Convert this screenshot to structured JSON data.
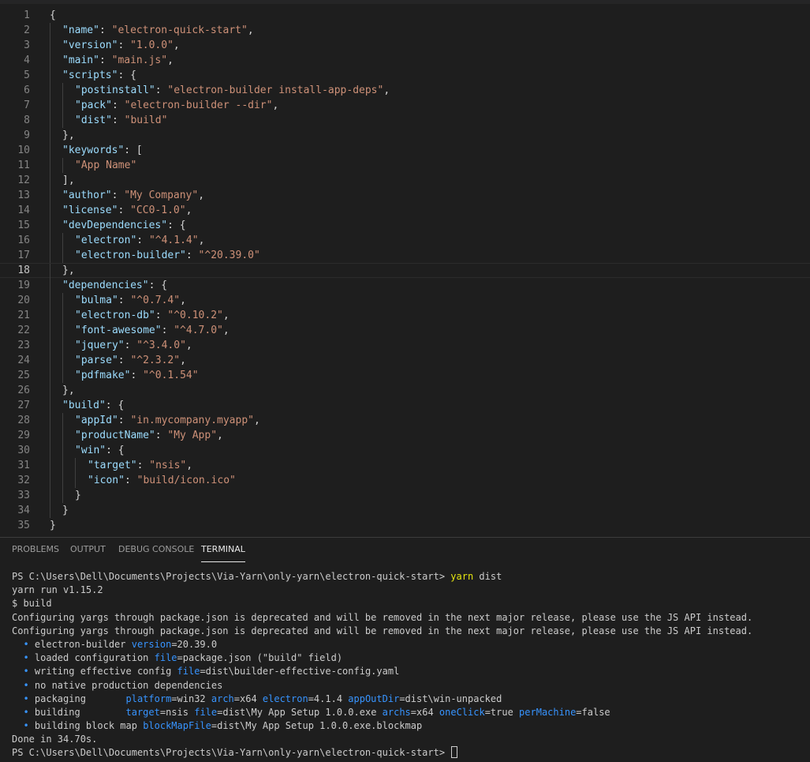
{
  "editor": {
    "active_line": 18,
    "lines": [
      {
        "n": "1",
        "indent": 0,
        "tokens": [
          {
            "c": "p",
            "t": "{"
          }
        ]
      },
      {
        "n": "2",
        "indent": 1,
        "tokens": [
          {
            "c": "k",
            "t": "\"name\""
          },
          {
            "c": "p",
            "t": ": "
          },
          {
            "c": "s",
            "t": "\"electron-quick-start\""
          },
          {
            "c": "p",
            "t": ","
          }
        ]
      },
      {
        "n": "3",
        "indent": 1,
        "tokens": [
          {
            "c": "k",
            "t": "\"version\""
          },
          {
            "c": "p",
            "t": ": "
          },
          {
            "c": "s",
            "t": "\"1.0.0\""
          },
          {
            "c": "p",
            "t": ","
          }
        ]
      },
      {
        "n": "4",
        "indent": 1,
        "tokens": [
          {
            "c": "k",
            "t": "\"main\""
          },
          {
            "c": "p",
            "t": ": "
          },
          {
            "c": "s",
            "t": "\"main.js\""
          },
          {
            "c": "p",
            "t": ","
          }
        ]
      },
      {
        "n": "5",
        "indent": 1,
        "tokens": [
          {
            "c": "k",
            "t": "\"scripts\""
          },
          {
            "c": "p",
            "t": ": {"
          }
        ]
      },
      {
        "n": "6",
        "indent": 2,
        "tokens": [
          {
            "c": "k",
            "t": "\"postinstall\""
          },
          {
            "c": "p",
            "t": ": "
          },
          {
            "c": "s",
            "t": "\"electron-builder install-app-deps\""
          },
          {
            "c": "p",
            "t": ","
          }
        ]
      },
      {
        "n": "7",
        "indent": 2,
        "tokens": [
          {
            "c": "k",
            "t": "\"pack\""
          },
          {
            "c": "p",
            "t": ": "
          },
          {
            "c": "s",
            "t": "\"electron-builder --dir\""
          },
          {
            "c": "p",
            "t": ","
          }
        ]
      },
      {
        "n": "8",
        "indent": 2,
        "tokens": [
          {
            "c": "k",
            "t": "\"dist\""
          },
          {
            "c": "p",
            "t": ": "
          },
          {
            "c": "s",
            "t": "\"build\""
          }
        ]
      },
      {
        "n": "9",
        "indent": 1,
        "tokens": [
          {
            "c": "p",
            "t": "},"
          }
        ]
      },
      {
        "n": "10",
        "indent": 1,
        "tokens": [
          {
            "c": "k",
            "t": "\"keywords\""
          },
          {
            "c": "p",
            "t": ": ["
          }
        ]
      },
      {
        "n": "11",
        "indent": 2,
        "tokens": [
          {
            "c": "s",
            "t": "\"App Name\""
          }
        ]
      },
      {
        "n": "12",
        "indent": 1,
        "tokens": [
          {
            "c": "p",
            "t": "],"
          }
        ]
      },
      {
        "n": "13",
        "indent": 1,
        "tokens": [
          {
            "c": "k",
            "t": "\"author\""
          },
          {
            "c": "p",
            "t": ": "
          },
          {
            "c": "s",
            "t": "\"My Company\""
          },
          {
            "c": "p",
            "t": ","
          }
        ]
      },
      {
        "n": "14",
        "indent": 1,
        "tokens": [
          {
            "c": "k",
            "t": "\"license\""
          },
          {
            "c": "p",
            "t": ": "
          },
          {
            "c": "s",
            "t": "\"CC0-1.0\""
          },
          {
            "c": "p",
            "t": ","
          }
        ]
      },
      {
        "n": "15",
        "indent": 1,
        "tokens": [
          {
            "c": "k",
            "t": "\"devDependencies\""
          },
          {
            "c": "p",
            "t": ": {"
          }
        ]
      },
      {
        "n": "16",
        "indent": 2,
        "tokens": [
          {
            "c": "k",
            "t": "\"electron\""
          },
          {
            "c": "p",
            "t": ": "
          },
          {
            "c": "s",
            "t": "\"^4.1.4\""
          },
          {
            "c": "p",
            "t": ","
          }
        ]
      },
      {
        "n": "17",
        "indent": 2,
        "tokens": [
          {
            "c": "k",
            "t": "\"electron-builder\""
          },
          {
            "c": "p",
            "t": ": "
          },
          {
            "c": "s",
            "t": "\"^20.39.0\""
          }
        ]
      },
      {
        "n": "18",
        "indent": 1,
        "tokens": [
          {
            "c": "p",
            "t": "},"
          }
        ]
      },
      {
        "n": "19",
        "indent": 1,
        "tokens": [
          {
            "c": "k",
            "t": "\"dependencies\""
          },
          {
            "c": "p",
            "t": ": {"
          }
        ]
      },
      {
        "n": "20",
        "indent": 2,
        "tokens": [
          {
            "c": "k",
            "t": "\"bulma\""
          },
          {
            "c": "p",
            "t": ": "
          },
          {
            "c": "s",
            "t": "\"^0.7.4\""
          },
          {
            "c": "p",
            "t": ","
          }
        ]
      },
      {
        "n": "21",
        "indent": 2,
        "tokens": [
          {
            "c": "k",
            "t": "\"electron-db\""
          },
          {
            "c": "p",
            "t": ": "
          },
          {
            "c": "s",
            "t": "\"^0.10.2\""
          },
          {
            "c": "p",
            "t": ","
          }
        ]
      },
      {
        "n": "22",
        "indent": 2,
        "tokens": [
          {
            "c": "k",
            "t": "\"font-awesome\""
          },
          {
            "c": "p",
            "t": ": "
          },
          {
            "c": "s",
            "t": "\"^4.7.0\""
          },
          {
            "c": "p",
            "t": ","
          }
        ]
      },
      {
        "n": "23",
        "indent": 2,
        "tokens": [
          {
            "c": "k",
            "t": "\"jquery\""
          },
          {
            "c": "p",
            "t": ": "
          },
          {
            "c": "s",
            "t": "\"^3.4.0\""
          },
          {
            "c": "p",
            "t": ","
          }
        ]
      },
      {
        "n": "24",
        "indent": 2,
        "tokens": [
          {
            "c": "k",
            "t": "\"parse\""
          },
          {
            "c": "p",
            "t": ": "
          },
          {
            "c": "s",
            "t": "\"^2.3.2\""
          },
          {
            "c": "p",
            "t": ","
          }
        ]
      },
      {
        "n": "25",
        "indent": 2,
        "tokens": [
          {
            "c": "k",
            "t": "\"pdfmake\""
          },
          {
            "c": "p",
            "t": ": "
          },
          {
            "c": "s",
            "t": "\"^0.1.54\""
          }
        ]
      },
      {
        "n": "26",
        "indent": 1,
        "tokens": [
          {
            "c": "p",
            "t": "},"
          }
        ]
      },
      {
        "n": "27",
        "indent": 1,
        "tokens": [
          {
            "c": "k",
            "t": "\"build\""
          },
          {
            "c": "p",
            "t": ": {"
          }
        ]
      },
      {
        "n": "28",
        "indent": 2,
        "tokens": [
          {
            "c": "k",
            "t": "\"appId\""
          },
          {
            "c": "p",
            "t": ": "
          },
          {
            "c": "s",
            "t": "\"in.mycompany.myapp\""
          },
          {
            "c": "p",
            "t": ","
          }
        ]
      },
      {
        "n": "29",
        "indent": 2,
        "tokens": [
          {
            "c": "k",
            "t": "\"productName\""
          },
          {
            "c": "p",
            "t": ": "
          },
          {
            "c": "s",
            "t": "\"My App\""
          },
          {
            "c": "p",
            "t": ","
          }
        ]
      },
      {
        "n": "30",
        "indent": 2,
        "tokens": [
          {
            "c": "k",
            "t": "\"win\""
          },
          {
            "c": "p",
            "t": ": {"
          }
        ]
      },
      {
        "n": "31",
        "indent": 3,
        "tokens": [
          {
            "c": "k",
            "t": "\"target\""
          },
          {
            "c": "p",
            "t": ": "
          },
          {
            "c": "s",
            "t": "\"nsis\""
          },
          {
            "c": "p",
            "t": ","
          }
        ]
      },
      {
        "n": "32",
        "indent": 3,
        "tokens": [
          {
            "c": "k",
            "t": "\"icon\""
          },
          {
            "c": "p",
            "t": ": "
          },
          {
            "c": "s",
            "t": "\"build/icon.ico\""
          }
        ]
      },
      {
        "n": "33",
        "indent": 2,
        "tokens": [
          {
            "c": "p",
            "t": "}"
          }
        ]
      },
      {
        "n": "34",
        "indent": 1,
        "tokens": [
          {
            "c": "p",
            "t": "}"
          }
        ]
      },
      {
        "n": "35",
        "indent": 0,
        "tokens": [
          {
            "c": "p",
            "t": "}"
          }
        ]
      }
    ]
  },
  "panel": {
    "tabs": [
      {
        "label": "PROBLEMS",
        "active": false
      },
      {
        "label": "OUTPUT",
        "active": false
      },
      {
        "label": "DEBUG CONSOLE",
        "active": false
      },
      {
        "label": "TERMINAL",
        "active": true
      }
    ],
    "terminal_lines": [
      [
        {
          "c": "",
          "t": "PS C:\\Users\\Dell\\Documents\\Projects\\Via-Yarn\\only-yarn\\electron-quick-start> "
        },
        {
          "c": "y",
          "t": "yarn"
        },
        {
          "c": "",
          "t": " dist"
        }
      ],
      [
        {
          "c": "",
          "t": "yarn run v1.15.2"
        }
      ],
      [
        {
          "c": "",
          "t": "$ build"
        }
      ],
      [
        {
          "c": "",
          "t": "Configuring yargs through package.json is deprecated and will be removed in the next major release, please use the JS API instead."
        }
      ],
      [
        {
          "c": "",
          "t": "Configuring yargs through package.json is deprecated and will be removed in the next major release, please use the JS API instead."
        }
      ],
      [
        {
          "c": "bul",
          "t": "  • "
        },
        {
          "c": "",
          "t": "electron-builder "
        },
        {
          "c": "b",
          "t": "version"
        },
        {
          "c": "",
          "t": "=20.39.0"
        }
      ],
      [
        {
          "c": "bul",
          "t": "  • "
        },
        {
          "c": "",
          "t": "loaded configuration "
        },
        {
          "c": "b",
          "t": "file"
        },
        {
          "c": "",
          "t": "=package.json (\"build\" field)"
        }
      ],
      [
        {
          "c": "bul",
          "t": "  • "
        },
        {
          "c": "",
          "t": "writing effective config "
        },
        {
          "c": "b",
          "t": "file"
        },
        {
          "c": "",
          "t": "=dist\\builder-effective-config.yaml"
        }
      ],
      [
        {
          "c": "bul",
          "t": "  • "
        },
        {
          "c": "",
          "t": "no native production dependencies"
        }
      ],
      [
        {
          "c": "bul",
          "t": "  • "
        },
        {
          "c": "",
          "t": "packaging       "
        },
        {
          "c": "b",
          "t": "platform"
        },
        {
          "c": "",
          "t": "=win32 "
        },
        {
          "c": "b",
          "t": "arch"
        },
        {
          "c": "",
          "t": "=x64 "
        },
        {
          "c": "b",
          "t": "electron"
        },
        {
          "c": "",
          "t": "=4.1.4 "
        },
        {
          "c": "b",
          "t": "appOutDir"
        },
        {
          "c": "",
          "t": "=dist\\win-unpacked"
        }
      ],
      [
        {
          "c": "bul",
          "t": "  • "
        },
        {
          "c": "",
          "t": "building        "
        },
        {
          "c": "b",
          "t": "target"
        },
        {
          "c": "",
          "t": "=nsis "
        },
        {
          "c": "b",
          "t": "file"
        },
        {
          "c": "",
          "t": "=dist\\My App Setup 1.0.0.exe "
        },
        {
          "c": "b",
          "t": "archs"
        },
        {
          "c": "",
          "t": "=x64 "
        },
        {
          "c": "b",
          "t": "oneClick"
        },
        {
          "c": "",
          "t": "=true "
        },
        {
          "c": "b",
          "t": "perMachine"
        },
        {
          "c": "",
          "t": "=false"
        }
      ],
      [
        {
          "c": "bul",
          "t": "  • "
        },
        {
          "c": "",
          "t": "building block map "
        },
        {
          "c": "b",
          "t": "blockMapFile"
        },
        {
          "c": "",
          "t": "=dist\\My App Setup 1.0.0.exe.blockmap"
        }
      ],
      [
        {
          "c": "",
          "t": "Done in 34.70s."
        }
      ],
      [
        {
          "c": "",
          "t": "PS C:\\Users\\Dell\\Documents\\Projects\\Via-Yarn\\only-yarn\\electron-quick-start> "
        }
      ]
    ]
  }
}
